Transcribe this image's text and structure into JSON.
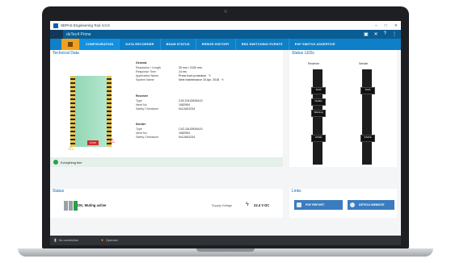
{
  "window": {
    "title": "SEPAS Engineering Tool 4.0.0",
    "controls": [
      "–",
      "□",
      "✕"
    ]
  },
  "app": {
    "name": "deTec4 Prime",
    "header_icons": [
      "save-icon",
      "close-icon",
      "help-icon",
      "more-icon"
    ]
  },
  "tabs": [
    {
      "label": "CONFIGURATION"
    },
    {
      "label": "DATA RECORDER"
    },
    {
      "label": "BEAM STATUS"
    },
    {
      "label": "ERROR HISTORY"
    },
    {
      "label": "RED SWITCHING EVENTS"
    },
    {
      "label": "ESP SWITCH ASSERTIVE"
    }
  ],
  "technical": {
    "title": "Technical Data",
    "red_tag": "STOP",
    "general": {
      "heading": "General",
      "rows": [
        {
          "k": "Resolution / Length",
          "v": "30 mm / 2100 mm"
        },
        {
          "k": "Response Time",
          "v": "14 ms"
        },
        {
          "k": "Application Name",
          "v": "Press front protection"
        },
        {
          "k": "System Name",
          "v": "Next maintenance 15 Apr. 2018"
        }
      ]
    },
    "receiver": {
      "heading": "Receiver",
      "rows": [
        {
          "k": "Type",
          "v": "C4C-EA13930A10"
        },
        {
          "k": "Ident No",
          "v": "1082904"
        },
        {
          "k": "Safety Checksum",
          "v": "0x12A51234"
        }
      ]
    },
    "sender": {
      "heading": "Sender",
      "rows": [
        {
          "k": "Type",
          "v": "C4C-SA13930A10"
        },
        {
          "k": "Ident No",
          "v": "1082904"
        },
        {
          "k": "Safety Checksum",
          "v": "0x12A51234"
        }
      ]
    },
    "ok_text": "Everything fine"
  },
  "leds": {
    "title": "Status LEDs",
    "receiver_label": "Receiver",
    "sender_label": "Sender",
    "receiver_badges": [
      "Field",
      "Quality",
      "Warning",
      "OSSD"
    ],
    "sender_badges": [
      "Field",
      "STATE"
    ]
  },
  "status": {
    "title": "Status",
    "text": "OK, Muting active",
    "supply_label": "Supply Voltage",
    "supply_value": "22.4 V DC"
  },
  "links": {
    "title": "Links",
    "buttons": [
      "PDF REPORT",
      "DETEC4 WEBSITE"
    ]
  },
  "statusbar": {
    "connection": "No connection",
    "user": "Operator"
  },
  "colors": {
    "brand_blue": "#0a5d93",
    "tab_blue": "#0f7fc8",
    "home_orange": "#f0a020",
    "ok_green": "#27a048",
    "alert_red": "#d42a2a"
  }
}
